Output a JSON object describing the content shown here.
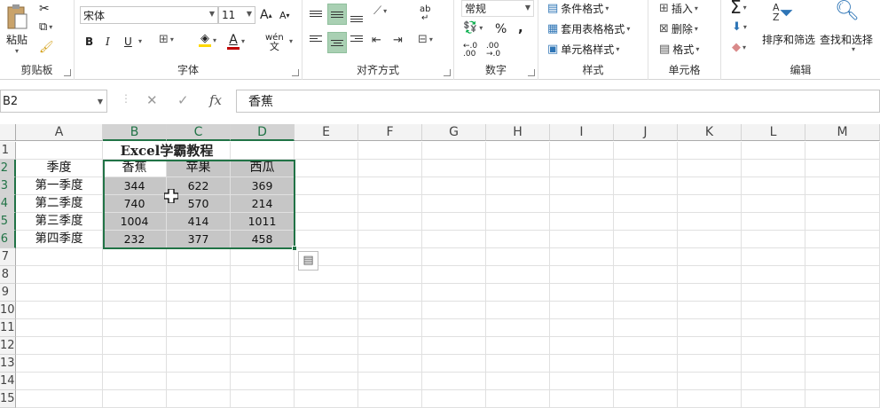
{
  "ribbon": {
    "clipboard": {
      "label": "剪贴板",
      "paste": "粘贴"
    },
    "font": {
      "label": "字体",
      "name": "宋体",
      "size": "11",
      "grow": "A",
      "shrink": "A",
      "bold": "B",
      "italic": "I",
      "underline": "U",
      "font_color": "A",
      "phonetic": "wén"
    },
    "alignment": {
      "label": "对齐方式",
      "wrap": "ab"
    },
    "number": {
      "label": "数字",
      "format": "常规",
      "percent": "%",
      "comma": ",",
      "dec_inc": "←.0 .00",
      "dec_dec": ".00 →.0"
    },
    "styles": {
      "label": "样式",
      "conditional": "条件格式",
      "table": "套用表格格式",
      "cell_styles": "单元格样式"
    },
    "cells": {
      "label": "单元格",
      "insert": "插入",
      "delete": "删除",
      "format": "格式"
    },
    "editing": {
      "label": "编辑",
      "sort": "排序和筛选",
      "find": "查找和选择"
    }
  },
  "formula_bar": {
    "name_box": "B2",
    "cancel": "✕",
    "enter": "✓",
    "fx": "fx",
    "content": "香蕉"
  },
  "sheet": {
    "columns": [
      "A",
      "B",
      "C",
      "D",
      "E",
      "F",
      "G",
      "H",
      "I",
      "J",
      "K",
      "L",
      "M"
    ],
    "rows": [
      "1",
      "2",
      "3",
      "4",
      "5",
      "6",
      "7",
      "8",
      "9",
      "10",
      "11",
      "12",
      "13",
      "14",
      "15"
    ],
    "title": "Excel学霸教程",
    "header_row": [
      "季度",
      "香蕉",
      "苹果",
      "西瓜"
    ],
    "data": [
      [
        "第一季度",
        "344",
        "622",
        "369"
      ],
      [
        "第二季度",
        "740",
        "570",
        "214"
      ],
      [
        "第三季度",
        "1004",
        "414",
        "1011"
      ],
      [
        "第四季度",
        "232",
        "377",
        "458"
      ]
    ],
    "selection": "B2:D6",
    "colors": {
      "accent": "#217346",
      "selection_fill": "#c6c6c6"
    }
  }
}
